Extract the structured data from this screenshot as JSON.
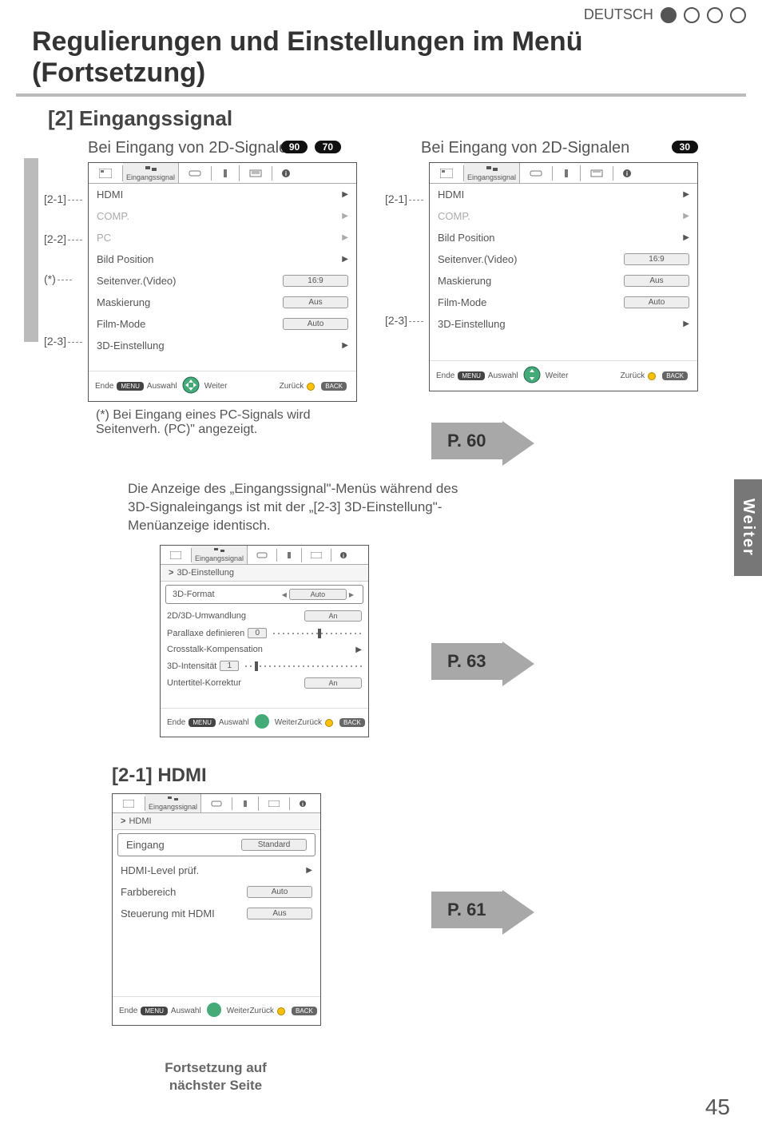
{
  "header": {
    "language_label": "DEUTSCH"
  },
  "page": {
    "title": "Regulierungen und Einstellungen im Menü (Fortsetzung)",
    "number": "45"
  },
  "section": {
    "heading": "[2] Eingangssignal"
  },
  "ui": {
    "tab_label_input": "Eingangssignal",
    "footer_end": "Ende",
    "footer_menu": "MENU",
    "footer_select": "Auswahl",
    "footer_next": "Weiter",
    "footer_back": "Zurück",
    "footer_back_btn": "BACK"
  },
  "left_panel": {
    "caption": "Bei Eingang von 2D-Signalen",
    "badges": [
      "90",
      "70"
    ],
    "rows": {
      "hdmi": "HDMI",
      "comp": "COMP.",
      "pc": "PC",
      "bild": "Bild Position",
      "seiten": "Seitenver.(Video)",
      "seiten_val": "16:9",
      "mask": "Maskierung",
      "mask_val": "Aus",
      "film": "Film-Mode",
      "film_val": "Auto",
      "d3": "3D-Einstellung"
    },
    "callouts": {
      "c1": "[2-1]",
      "c2": "[2-2]",
      "c3": "(*)",
      "c4": "[2-3]"
    },
    "note_prefix": "(*)",
    "note_text": " Bei Eingang eines PC-Signals wird Seitenverh. (PC)\" angezeigt."
  },
  "right_panel": {
    "caption": "Bei Eingang von 2D-Signalen",
    "badges": [
      "30"
    ],
    "rows": {
      "hdmi": "HDMI",
      "comp": "COMP.",
      "bild": "Bild Position",
      "seiten": "Seitenver.(Video)",
      "seiten_val": "16:9",
      "mask": "Maskierung",
      "mask_val": "Aus",
      "film": "Film-Mode",
      "film_val": "Auto",
      "d3": "3D-Einstellung"
    },
    "callouts": {
      "c1": "[2-1]",
      "c2": "[2-3]"
    }
  },
  "mid_note": "Die Anzeige des „Eingangssignal\"-Menüs während des 3D-Signaleingangs ist mit der „[2-3] 3D-Einstellung\"-Menüanzeige identisch.",
  "mini_panel": {
    "breadcrumb": "3D-Einstellung",
    "rows": {
      "format": "3D-Format",
      "format_val": "Auto",
      "umw": "2D/3D-Umwandlung",
      "umw_val": "An",
      "par": "Parallaxe definieren",
      "par_val": "0",
      "cross": "Crosstalk-Kompensation",
      "int": "3D-Intensität",
      "int_val": "1",
      "unt": "Untertitel-Korrektur",
      "unt_val": "An"
    }
  },
  "hdmi_section": {
    "heading": "[2-1] HDMI",
    "breadcrumb": "HDMI",
    "rows": {
      "eingang": "Eingang",
      "eingang_val": "Standard",
      "level": "HDMI-Level prüf.",
      "farb": "Farbbereich",
      "farb_val": "Auto",
      "steuer": "Steuerung mit HDMI",
      "steuer_val": "Aus"
    },
    "cont_line1": "Fortsetzung auf",
    "cont_line2": "nächster Seite"
  },
  "page_refs": {
    "p60": "P. 60",
    "p63": "P. 63",
    "p61": "P. 61"
  },
  "side_tab": "Weiter"
}
